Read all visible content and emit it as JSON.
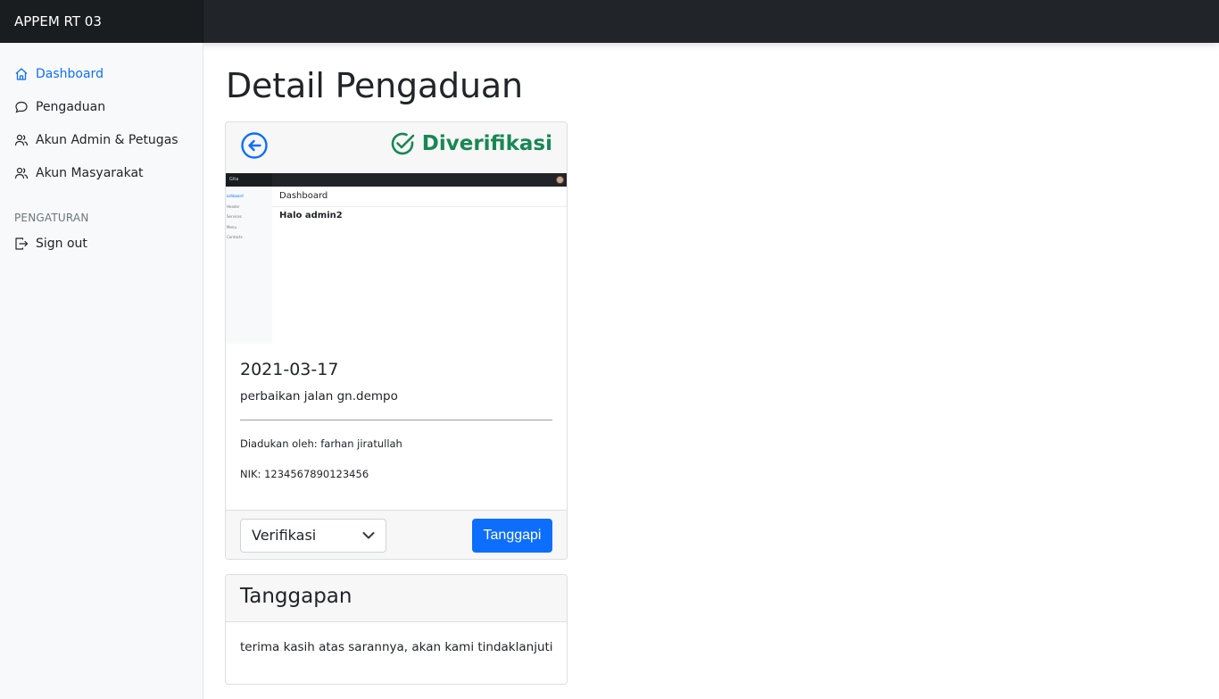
{
  "app": {
    "brand": "APPEM RT 03"
  },
  "sidebar": {
    "items": [
      {
        "label": "Dashboard",
        "icon": "home-icon",
        "active": true
      },
      {
        "label": "Pengaduan",
        "icon": "chat-icon"
      },
      {
        "label": "Akun Admin & Petugas",
        "icon": "users-icon"
      },
      {
        "label": "Akun Masyarakat",
        "icon": "users-icon"
      }
    ],
    "section_heading": "PENGATURAN",
    "signout_label": "Sign out"
  },
  "page": {
    "title": "Detail Pengaduan"
  },
  "complaint": {
    "status": "Diverifikasi",
    "status_color": "#198754",
    "date": "2021-03-17",
    "description": "perbaikan jalan gn.dempo",
    "reported_by": "Diadukan oleh: farhan jiratullah",
    "nik": "NIK: 1234567890123456",
    "attachment": {
      "brand": "Gita",
      "sidebar": [
        "ashboard",
        "Header",
        "Services",
        "Menu",
        "Contacts"
      ],
      "title": "Dashboard",
      "greeting": "Halo admin2"
    }
  },
  "actions": {
    "status_select_value": "Verifikasi",
    "respond_label": "Tanggapi"
  },
  "response": {
    "title": "Tanggapan",
    "text": "terima kasih atas sarannya, akan kami tindaklanjuti"
  },
  "colors": {
    "primary": "#0d6efd",
    "dark": "#212529",
    "success": "#198754"
  }
}
